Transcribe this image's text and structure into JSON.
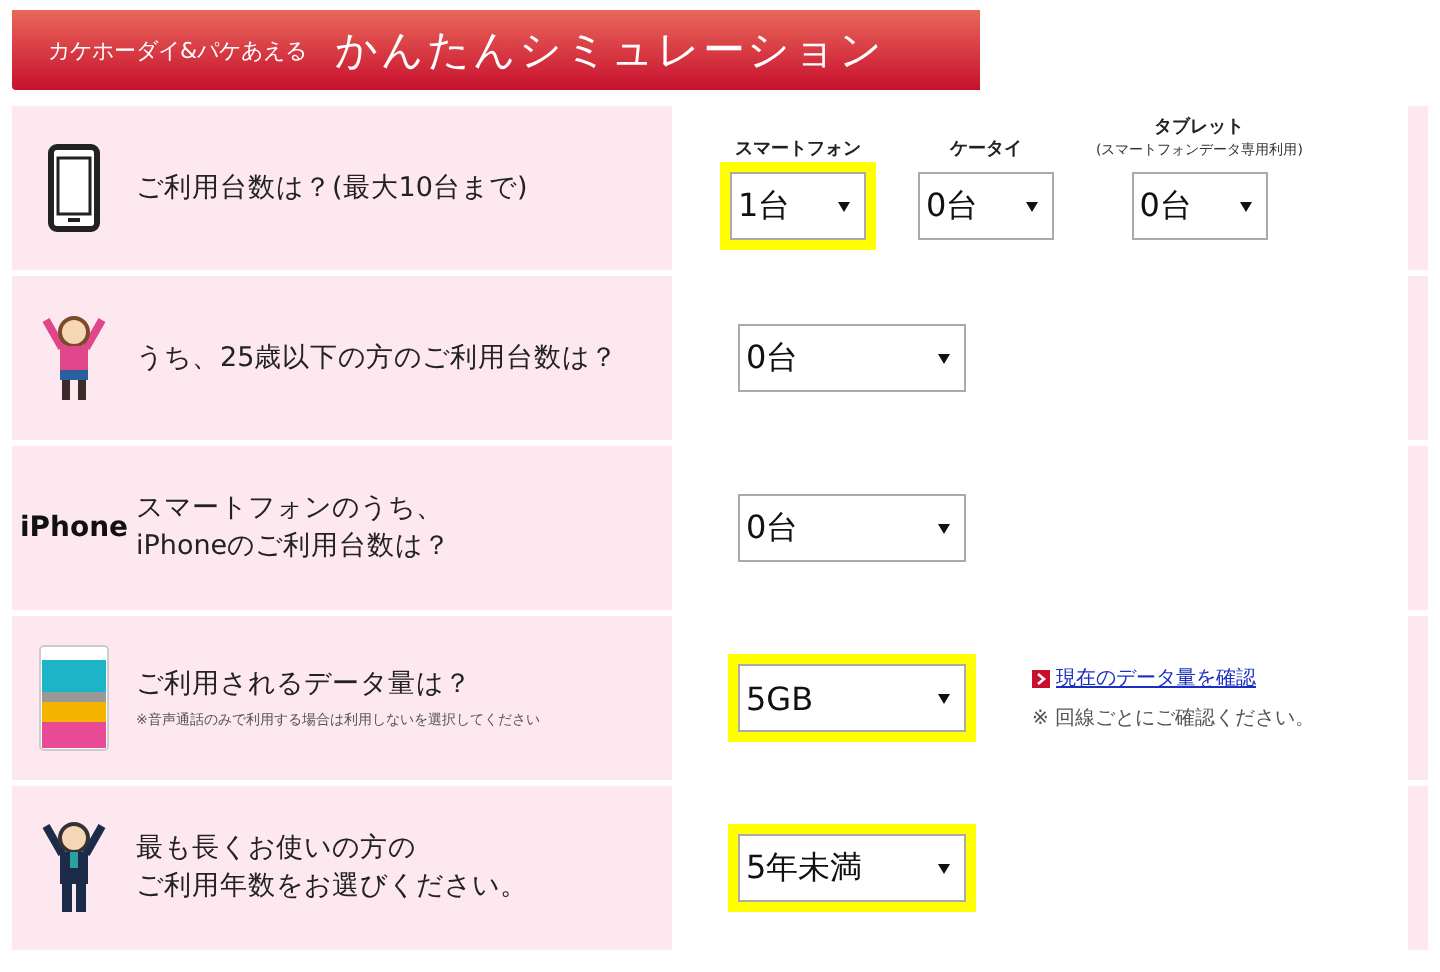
{
  "header": {
    "subtitle": "カケホーダイ&パケあえる",
    "title": "かんたんシミュレーション"
  },
  "rows": [
    {
      "kind": "phone",
      "lines": [
        "ご利用台数は？(最大10台まで)"
      ],
      "selects": [
        {
          "heading": "スマートフォン",
          "value": "1台",
          "highlighted": true
        },
        {
          "heading": "ケータイ",
          "value": "0台",
          "highlighted": false
        },
        {
          "heading": "タブレット",
          "subheading": "(スマートフォンデータ専用利用)",
          "value": "0台",
          "highlighted": false
        }
      ]
    },
    {
      "kind": "girl",
      "lines": [
        "うち、25歳以下の方のご利用台数は？"
      ],
      "selects": [
        {
          "value": "0台",
          "highlighted": false
        }
      ]
    },
    {
      "kind": "iphone",
      "icon_text": "iPhone",
      "lines": [
        "スマートフォンのうち、",
        "iPhoneのご利用台数は？"
      ],
      "selects": [
        {
          "value": "0台",
          "highlighted": false
        }
      ]
    },
    {
      "kind": "data",
      "lines": [
        "ご利用されるデータ量は？"
      ],
      "note": "※音声通話のみで利用する場合は利用しないを選択してください",
      "selects": [
        {
          "value": "5GB",
          "highlighted": true
        }
      ],
      "link": "現在のデータ量を確認",
      "link_note": "※ 回線ごとにご確認ください。"
    },
    {
      "kind": "man",
      "lines": [
        "最も長くお使いの方の",
        "ご利用年数をお選びください。"
      ],
      "selects": [
        {
          "value": "5年未満",
          "highlighted": true
        }
      ]
    }
  ]
}
